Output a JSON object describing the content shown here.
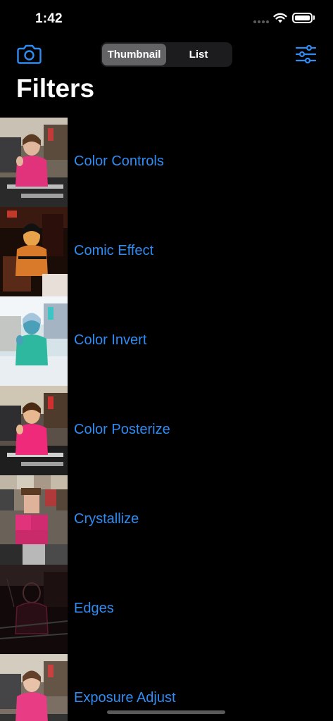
{
  "status": {
    "time": "1:42"
  },
  "header": {
    "camera_icon": "camera-icon",
    "settings_icon": "sliders-icon",
    "segments": [
      "Thumbnail",
      "List"
    ],
    "selected_segment": "Thumbnail",
    "title": "Filters"
  },
  "colors": {
    "accent": "#2f8cf3",
    "background": "#000000",
    "segment_bg": "#1c1c1e",
    "segment_selected": "#636366"
  },
  "filters": [
    {
      "label": "Color Controls"
    },
    {
      "label": "Comic Effect"
    },
    {
      "label": "Color Invert"
    },
    {
      "label": "Color Posterize"
    },
    {
      "label": "Crystallize"
    },
    {
      "label": "Edges"
    },
    {
      "label": "Exposure Adjust"
    }
  ]
}
